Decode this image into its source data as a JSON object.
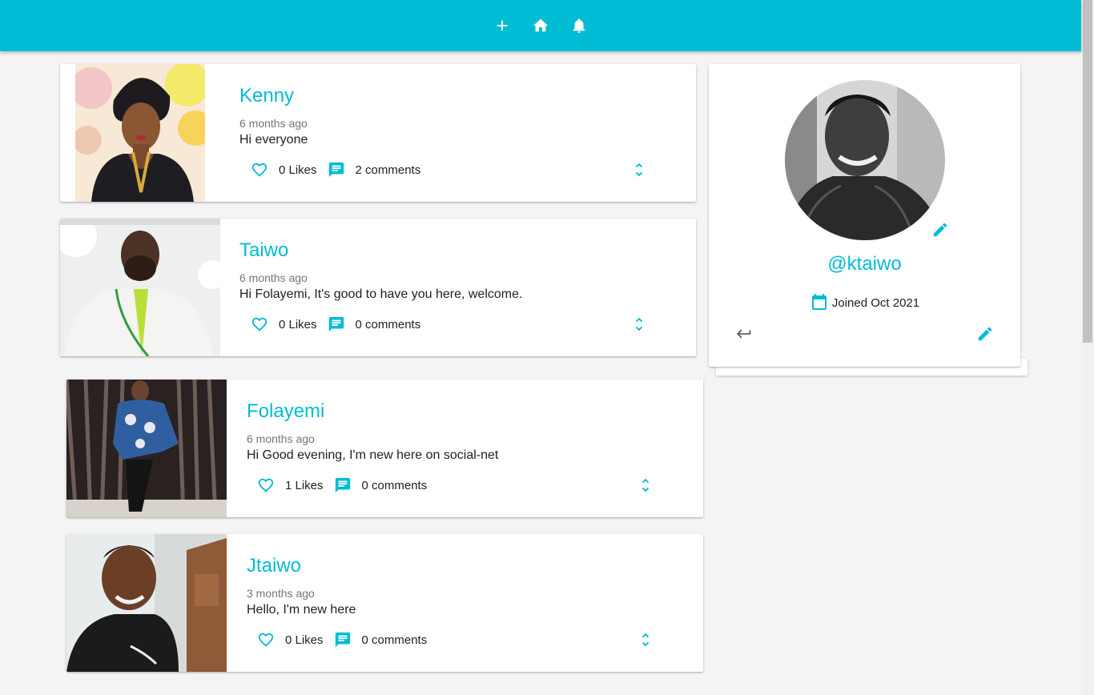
{
  "appbar": {
    "icons": [
      "add-icon",
      "home-icon",
      "notifications-icon"
    ]
  },
  "posts": [
    {
      "author": "Kenny",
      "time": "6 months ago",
      "body": "Hi everyone",
      "likes": "0 Likes",
      "comments": "2 comments"
    },
    {
      "author": "Taiwo",
      "time": "6 months ago",
      "body": "Hi Folayemi, It's good to have you here, welcome.",
      "likes": "0 Likes",
      "comments": "0 comments"
    },
    {
      "author": "Folayemi",
      "time": "6 months ago",
      "body": "Hi Good evening, I'm new here on social-net",
      "likes": "1 Likes",
      "comments": "0 comments"
    },
    {
      "author": "Jtaiwo",
      "time": "3 months ago",
      "body": "Hello, I'm new here",
      "likes": "0 Likes",
      "comments": "0 comments"
    }
  ],
  "profile": {
    "handle": "@ktaiwo",
    "joined": "Joined Oct 2021"
  },
  "colors": {
    "primary": "#00bcd4",
    "background": "#f4f4f4"
  }
}
